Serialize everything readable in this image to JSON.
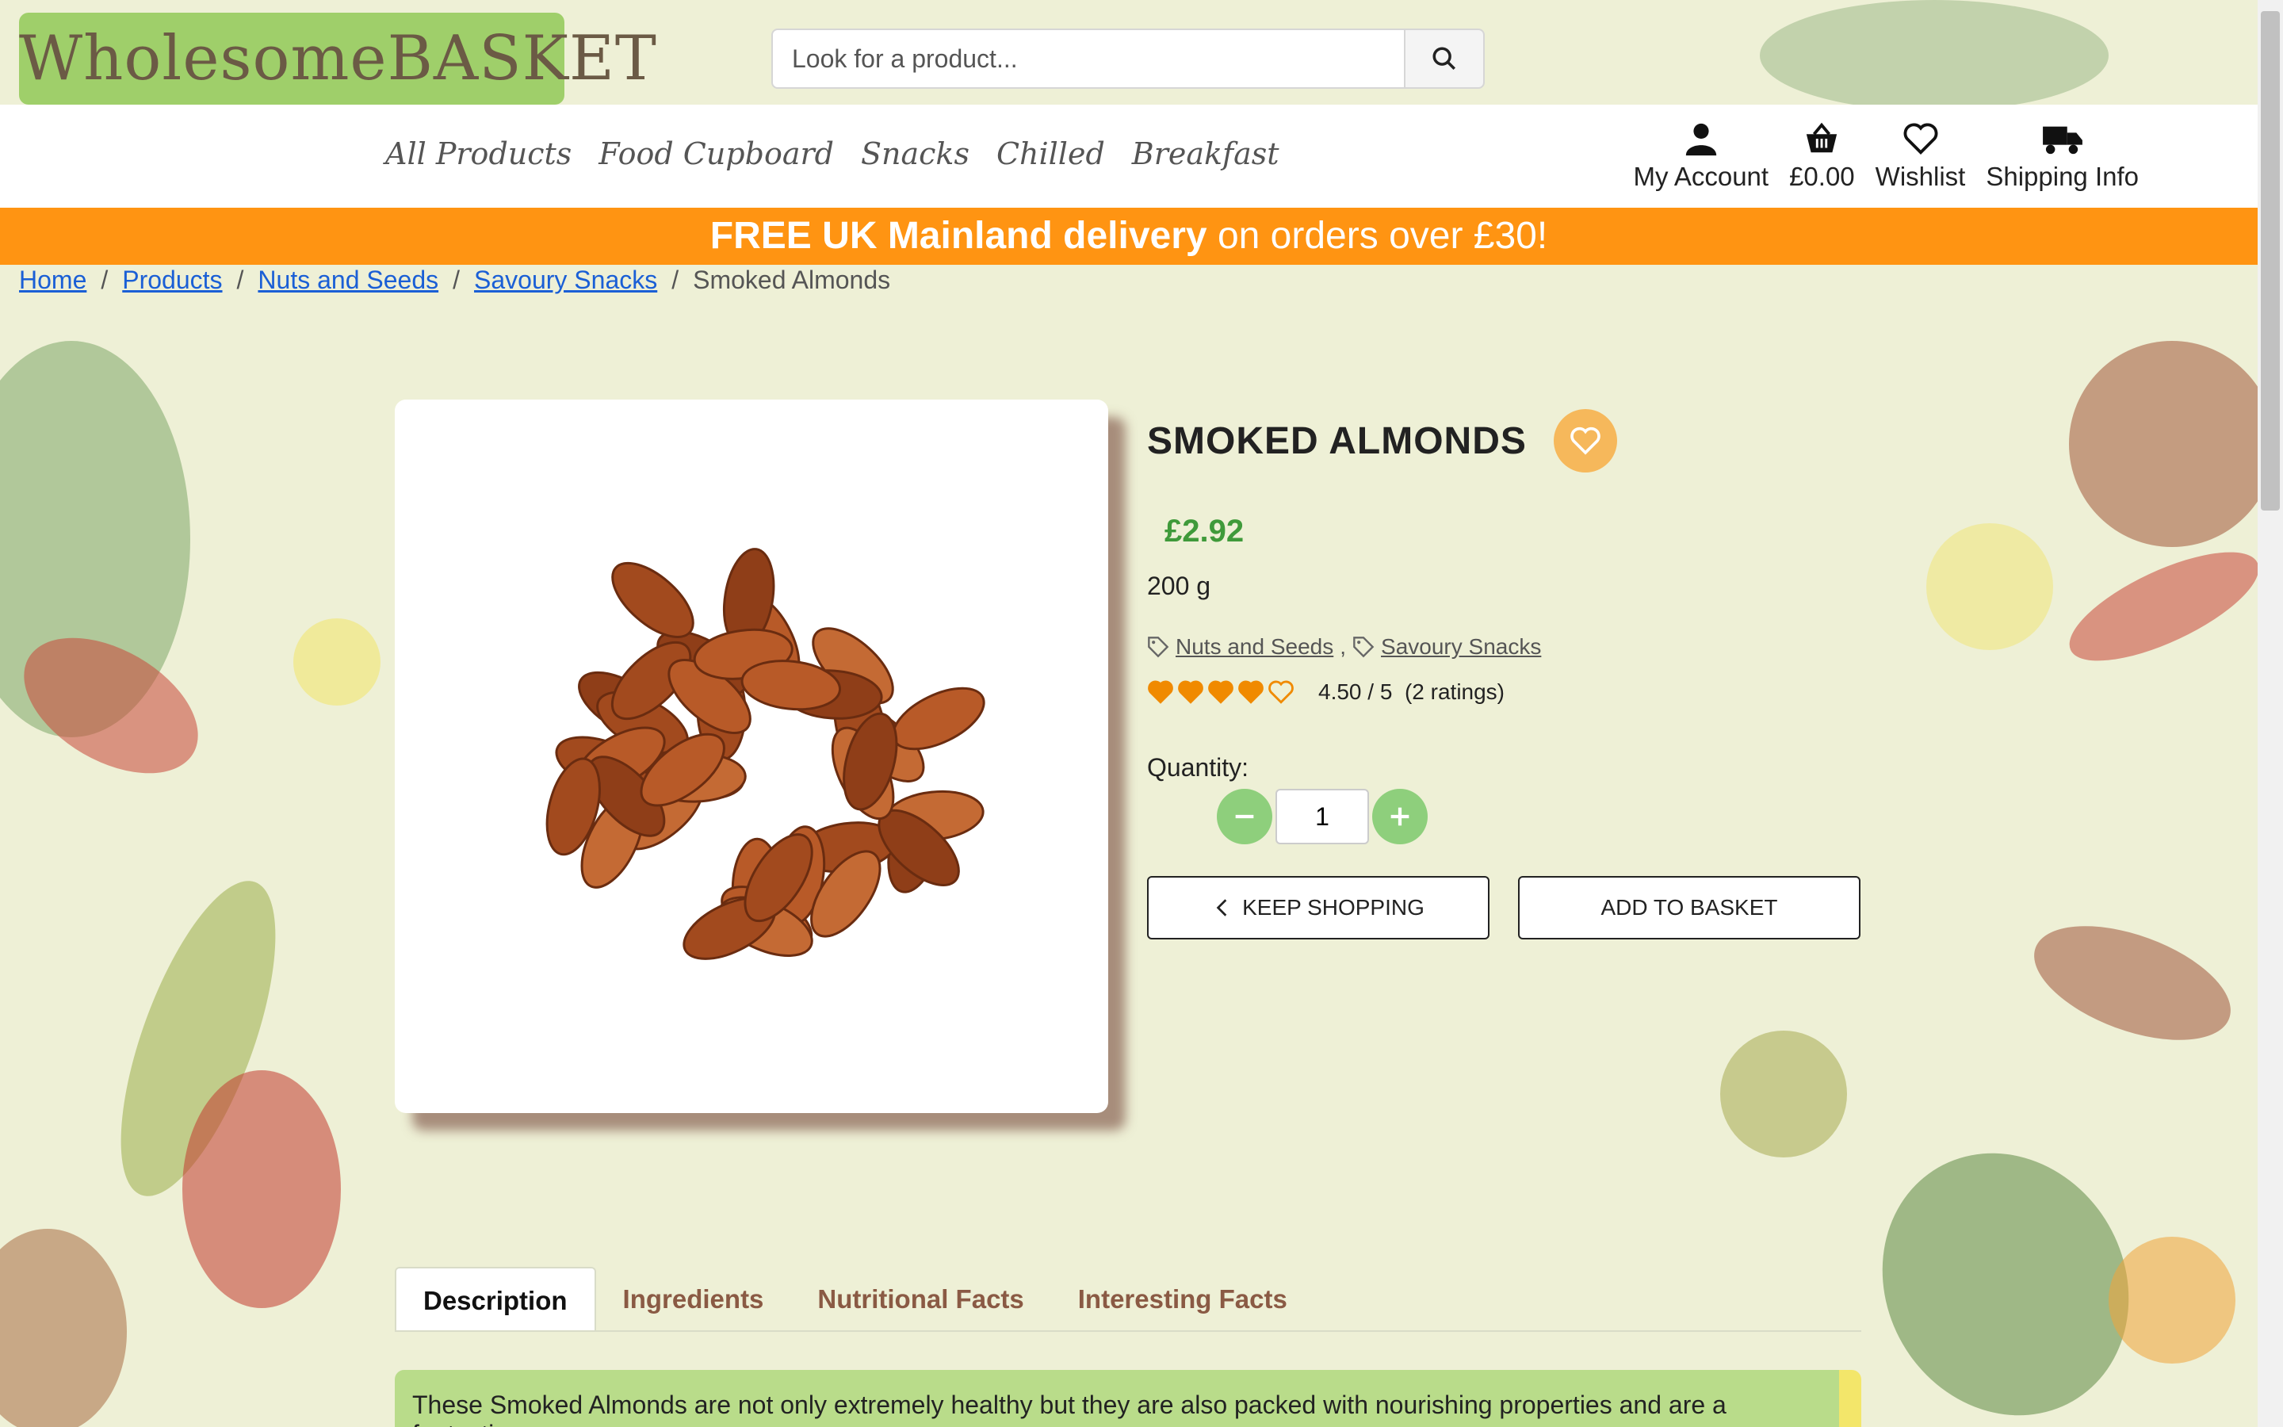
{
  "header": {
    "logo_text": "WholesomeBASKET",
    "search_placeholder": "Look for a product..."
  },
  "nav": {
    "categories": [
      "All Products",
      "Food Cupboard",
      "Snacks",
      "Chilled",
      "Breakfast"
    ],
    "account_label": "My Account",
    "basket_label": "£0.00",
    "wishlist_label": "Wishlist",
    "shipping_label": "Shipping Info"
  },
  "promo": {
    "bold": "FREE UK Mainland delivery",
    "rest": " on orders over £30!"
  },
  "breadcrumb": [
    "Home",
    "Products",
    "Nuts and Seeds",
    "Savoury Snacks",
    "Smoked Almonds"
  ],
  "product": {
    "title": "SMOKED ALMONDS",
    "price": "£2.92",
    "size": "200 g",
    "tags": [
      "Nuts and Seeds",
      "Savoury Snacks"
    ],
    "tag_separator": ",",
    "rating_value": 4.5,
    "rating_text": "4.50 / 5",
    "rating_count": "(2 ratings)",
    "quantity_label": "Quantity:",
    "quantity": "1",
    "keep_shopping": "KEEP SHOPPING",
    "add_to_basket": "ADD TO BASKET"
  },
  "tabs": [
    "Description",
    "Ingredients",
    "Nutritional Facts",
    "Interesting Facts"
  ],
  "description": "These Smoked Almonds are not only extremely healthy but they are also packed with nourishing properties and are a fantastic",
  "colors": {
    "accent_orange": "#ff9412",
    "logo_green": "#9fcf6a",
    "price_green": "#3f9a3a",
    "heart_orange": "#f6b85b"
  }
}
